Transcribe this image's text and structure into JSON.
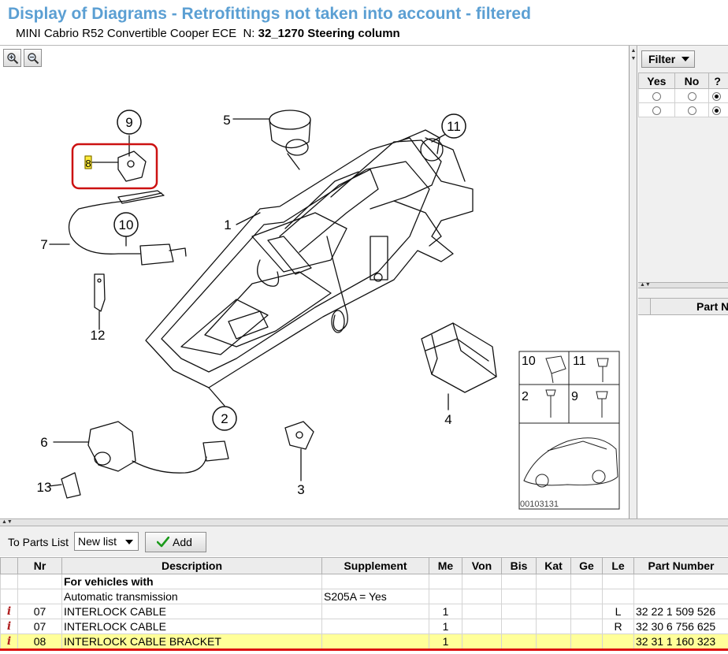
{
  "header": {
    "title": "Display of Diagrams - Retrofittings not taken into account - filtered",
    "vehicle": "MINI Cabrio R52 Convertible Cooper ECE",
    "group_prefix": "N:",
    "group": "32_1270 Steering column"
  },
  "diagram": {
    "callouts": [
      "1",
      "2",
      "3",
      "4",
      "5",
      "6",
      "7",
      "8",
      "9",
      "10",
      "11",
      "12",
      "13"
    ],
    "inset_labels": [
      "10",
      "11",
      "2",
      "9"
    ],
    "image_number": "00103131"
  },
  "filter": {
    "button_label": "Filter",
    "columns": [
      "Yes",
      "No",
      "?"
    ],
    "rows": [
      {
        "yes": false,
        "no": false,
        "unknown": true
      },
      {
        "yes": false,
        "no": false,
        "unknown": true
      }
    ]
  },
  "right_list": {
    "header": "Part N"
  },
  "toolbar": {
    "to_parts_list_label": "To Parts List",
    "list_value": "New list",
    "add_label": "Add"
  },
  "parts_table": {
    "columns": [
      "",
      "Nr",
      "Description",
      "Supplement",
      "Me",
      "Von",
      "Bis",
      "Kat",
      "Ge",
      "Le",
      "Part Number"
    ],
    "rows": [
      {
        "info": "",
        "nr": "",
        "desc": "For vehicles with",
        "supp": "",
        "me": "",
        "von": "",
        "bis": "",
        "kat": "",
        "ge": "",
        "le": "",
        "part": "",
        "bold": true
      },
      {
        "info": "",
        "nr": "",
        "desc": "Automatic transmission",
        "supp": "S205A = Yes",
        "me": "",
        "von": "",
        "bis": "",
        "kat": "",
        "ge": "",
        "le": "",
        "part": ""
      },
      {
        "info": "i",
        "nr": "07",
        "desc": "INTERLOCK CABLE",
        "supp": "",
        "me": "1",
        "von": "",
        "bis": "",
        "kat": "",
        "ge": "",
        "le": "L",
        "part": "32 22 1 509 526"
      },
      {
        "info": "i",
        "nr": "07",
        "desc": "INTERLOCK CABLE",
        "supp": "",
        "me": "1",
        "von": "",
        "bis": "",
        "kat": "",
        "ge": "",
        "le": "R",
        "part": "32 30 6 756 625"
      },
      {
        "info": "i",
        "nr": "08",
        "desc": "INTERLOCK CABLE BRACKET",
        "supp": "",
        "me": "1",
        "von": "",
        "bis": "",
        "kat": "",
        "ge": "",
        "le": "",
        "part": "32 31 1 160 323",
        "highlight": true
      }
    ]
  }
}
